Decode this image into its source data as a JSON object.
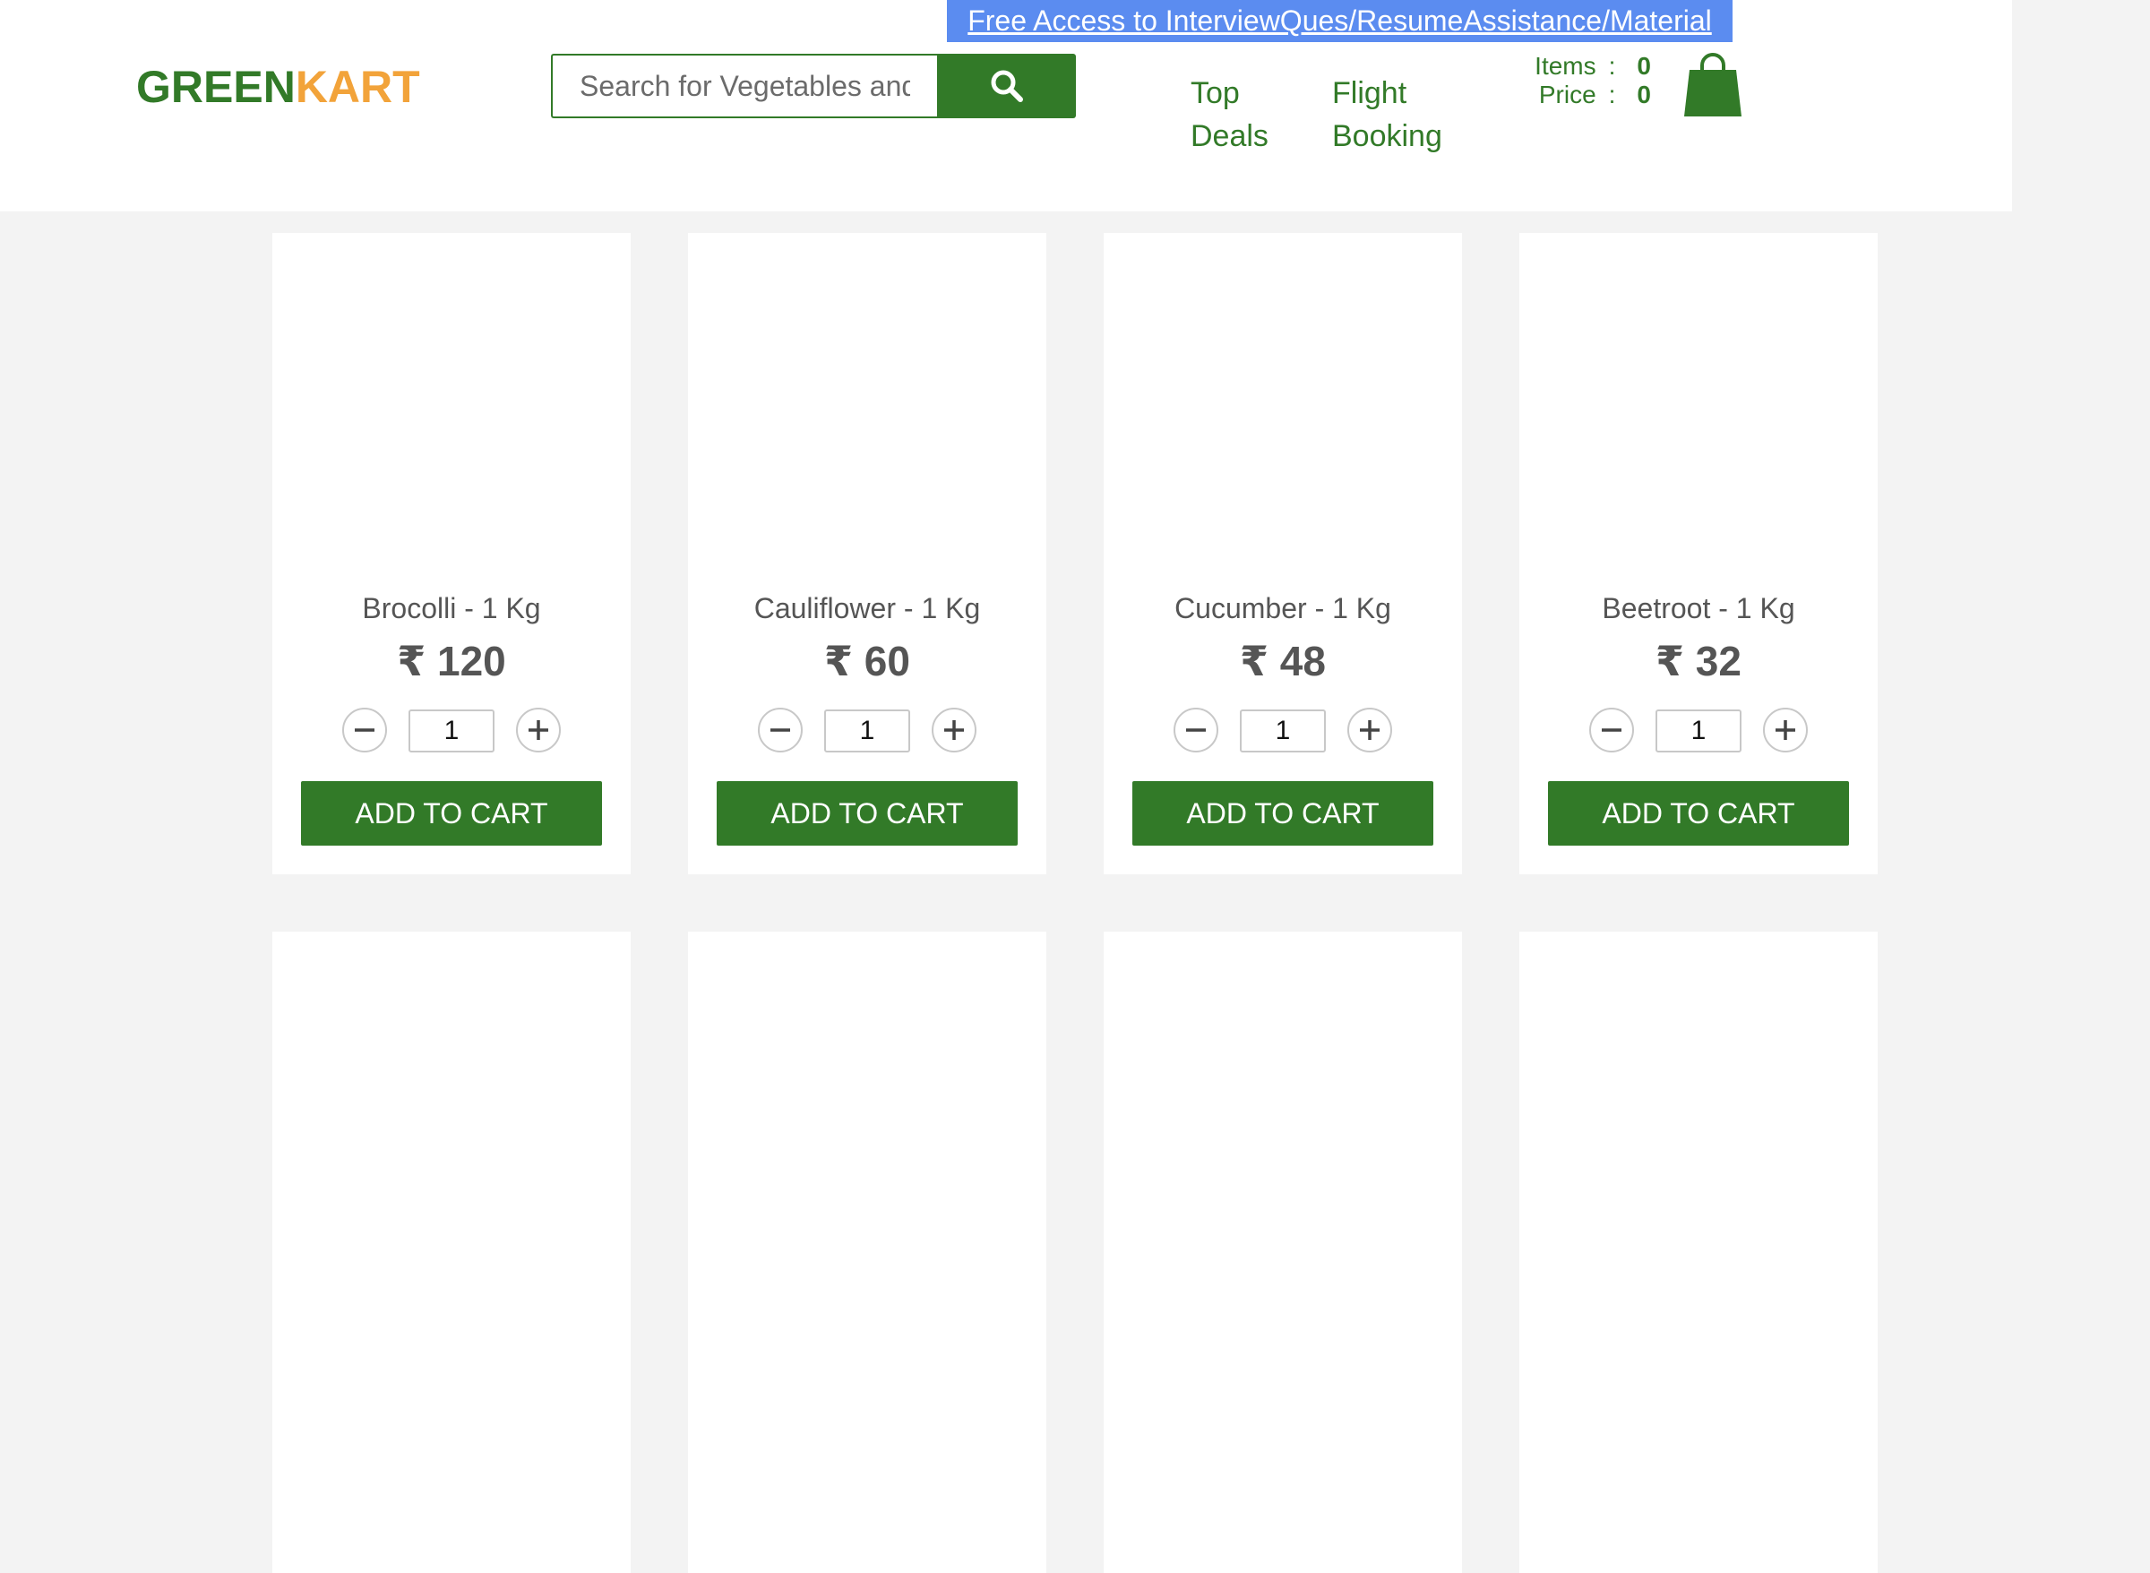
{
  "promo_banner": "Free Access to InterviewQues/ResumeAssistance/Material",
  "brand": {
    "part1": "GREEN",
    "part2": "KART",
    "color1": "#327a28",
    "color2": "#f2a33a"
  },
  "search": {
    "placeholder": "Search for Vegetables and Fruits",
    "button_icon": "search-icon"
  },
  "nav": {
    "top_deals_line1": "Top",
    "top_deals_line2": "Deals",
    "flight_line1": "Flight",
    "flight_line2": "Booking"
  },
  "cart": {
    "items_label": "Items",
    "items_value": "0",
    "price_label": "Price",
    "price_value": "0",
    "separator": ":",
    "icon": "shopping-bag-icon"
  },
  "colors": {
    "primary": "#327a28",
    "accent": "#f2a33a",
    "banner": "#5b8cf0",
    "background": "#f3f3f3"
  },
  "products": [
    {
      "name": "Brocolli - 1 Kg",
      "price": "₹ 120",
      "qty": "1",
      "add_label": "ADD TO CART"
    },
    {
      "name": "Cauliflower - 1 Kg",
      "price": "₹ 60",
      "qty": "1",
      "add_label": "ADD TO CART"
    },
    {
      "name": "Cucumber - 1 Kg",
      "price": "₹ 48",
      "qty": "1",
      "add_label": "ADD TO CART"
    },
    {
      "name": "Beetroot - 1 Kg",
      "price": "₹ 32",
      "qty": "1",
      "add_label": "ADD TO CART"
    },
    {
      "name": "",
      "price": "",
      "qty": "",
      "add_label": ""
    },
    {
      "name": "",
      "price": "",
      "qty": "",
      "add_label": ""
    },
    {
      "name": "",
      "price": "",
      "qty": "",
      "add_label": ""
    },
    {
      "name": "",
      "price": "",
      "qty": "",
      "add_label": ""
    }
  ]
}
